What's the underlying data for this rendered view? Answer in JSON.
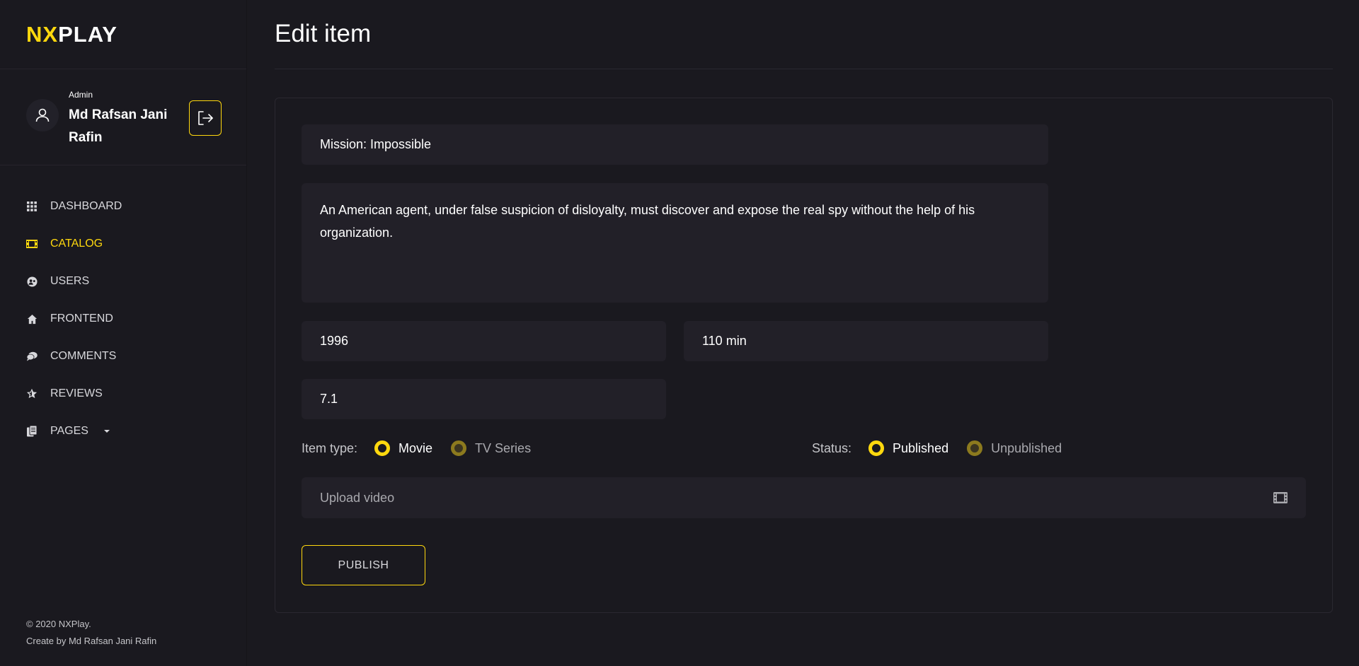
{
  "brand": {
    "highlight": "NX",
    "rest": "PLAY"
  },
  "user": {
    "role": "Admin",
    "name": "Md Rafsan Jani Rafin"
  },
  "nav": [
    {
      "label": "DASHBOARD",
      "icon": "grid-icon",
      "active": false
    },
    {
      "label": "CATALOG",
      "icon": "film-icon",
      "active": true
    },
    {
      "label": "USERS",
      "icon": "users-icon",
      "active": false
    },
    {
      "label": "FRONTEND",
      "icon": "home-icon",
      "active": false
    },
    {
      "label": "COMMENTS",
      "icon": "comments-icon",
      "active": false
    },
    {
      "label": "REVIEWS",
      "icon": "star-icon",
      "active": false
    },
    {
      "label": "PAGES",
      "icon": "pages-icon",
      "active": false
    }
  ],
  "footer": {
    "copyright": "© 2020 NXPlay.",
    "credit": "Create by Md Rafsan Jani Rafin"
  },
  "page": {
    "title": "Edit item"
  },
  "form": {
    "title_value": "Mission: Impossible",
    "description_value": "An American agent, under false suspicion of disloyalty, must discover and expose the real spy without the help of his organization.",
    "year_value": "1996",
    "duration_value": "110 min",
    "rating_value": "7.1",
    "item_type": {
      "label": "Item type:",
      "options": [
        "Movie",
        "TV Series"
      ],
      "selected": "Movie"
    },
    "status": {
      "label": "Status:",
      "options": [
        "Published",
        "Unpublished"
      ],
      "selected": "Published"
    },
    "upload_label": "Upload video",
    "publish_label": "PUBLISH"
  },
  "colors": {
    "accent": "#ffd80e",
    "background": "#1a191f",
    "field": "#222028"
  }
}
